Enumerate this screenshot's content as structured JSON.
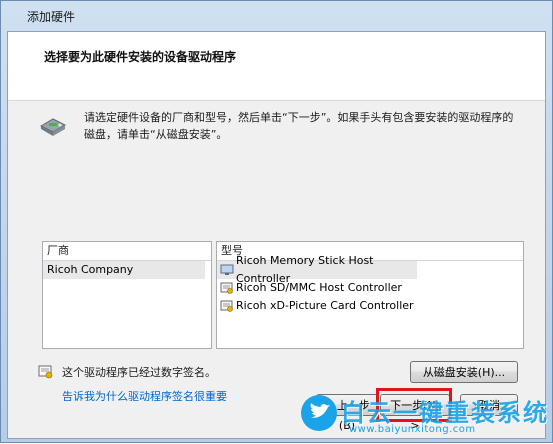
{
  "window": {
    "title": "添加硬件"
  },
  "header": {
    "heading": "选择要为此硬件安装的设备驱动程序"
  },
  "instruction": "请选定硬件设备的厂商和型号，然后单击“下一步”。如果手头有包含要安装的驱动程序的磁盘，请单击“从磁盘安装”。",
  "manufacturer_list": {
    "header": "厂商",
    "items": [
      "Ricoh Company"
    ]
  },
  "model_list": {
    "header": "型号",
    "items": [
      "Ricoh Memory Stick Host Controller",
      "Ricoh SD/MMC Host Controller",
      "Ricoh xD-Picture Card Controller"
    ]
  },
  "signature": {
    "text": "这个驱动程序已经过数字签名。",
    "link": "告诉我为什么驱动程序签名很重要"
  },
  "buttons": {
    "have_disk": "从磁盘安装(H)...",
    "back": "< 上一步(B)",
    "next": "下一步(N) >",
    "cancel": "取消"
  },
  "watermark": {
    "name": "白云一键重装系统",
    "url": "www.baiyunxitong.com"
  },
  "colors": {
    "highlight": "#e0141e",
    "link": "#0066cc",
    "watermark": "#1aa3e8"
  }
}
